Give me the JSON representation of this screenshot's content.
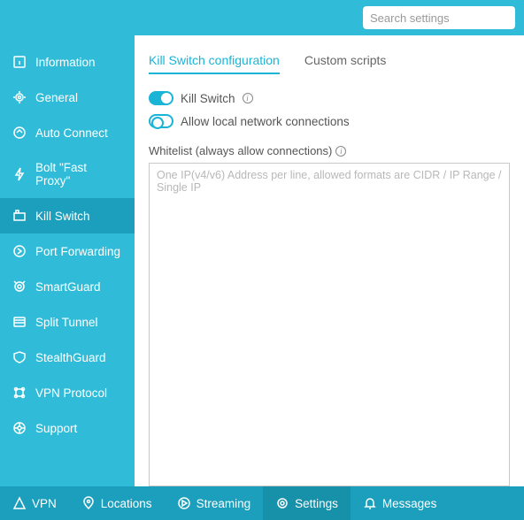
{
  "search": {
    "placeholder": "Search settings"
  },
  "sidebar": {
    "items": [
      {
        "label": "Information"
      },
      {
        "label": "General"
      },
      {
        "label": "Auto Connect"
      },
      {
        "label": "Bolt \"Fast Proxy\""
      },
      {
        "label": "Kill Switch"
      },
      {
        "label": "Port Forwarding"
      },
      {
        "label": "SmartGuard"
      },
      {
        "label": "Split Tunnel"
      },
      {
        "label": "StealthGuard"
      },
      {
        "label": "VPN Protocol"
      },
      {
        "label": "Support"
      }
    ],
    "active_index": 4
  },
  "tabs": {
    "items": [
      {
        "label": "Kill Switch configuration"
      },
      {
        "label": "Custom scripts"
      }
    ],
    "active_index": 0
  },
  "options": {
    "kill_switch": {
      "label": "Kill Switch",
      "enabled": true
    },
    "allow_local": {
      "label": "Allow local network connections",
      "enabled": false
    }
  },
  "whitelist": {
    "label": "Whitelist (always allow connections)",
    "placeholder": "One IP(v4/v6) Address per line, allowed formats are CIDR / IP Range / Single IP"
  },
  "bottombar": {
    "items": [
      {
        "label": "VPN"
      },
      {
        "label": "Locations"
      },
      {
        "label": "Streaming"
      },
      {
        "label": "Settings"
      },
      {
        "label": "Messages"
      }
    ],
    "active_index": 3
  }
}
